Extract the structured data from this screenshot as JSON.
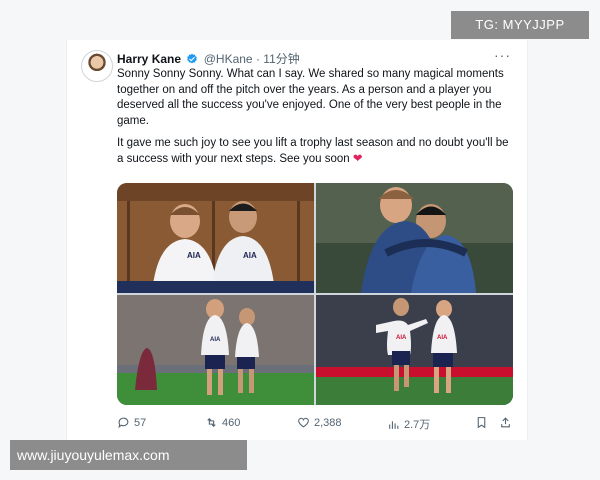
{
  "tweet": {
    "author_name": "Harry Kane",
    "handle": "@HKane",
    "separator": "·",
    "time_ago": "11分钟",
    "more_label": "···",
    "paragraph1": "Sonny Sonny Sonny. What can I say. We shared so many magical moments together on and off the pitch over the years. As a person and a player you deserved all the success you've enjoyed. One of the very best people in the game.",
    "paragraph2": "It gave me such joy to see you lift a trophy last season and no doubt you'll be a success with your next steps. See you soon",
    "heart_emoji": "❤",
    "verified_color": "#1d9bf0",
    "photos": [
      {
        "description_name": "kane-son-locker-room-photo"
      },
      {
        "description_name": "kane-son-hug-photo"
      },
      {
        "description_name": "kane-son-celebration-photo"
      },
      {
        "description_name": "son-kane-running-photo"
      }
    ],
    "jersey_text": "AIA"
  },
  "actions": {
    "replies": "57",
    "retweets": "460",
    "likes": "2,388",
    "views": "2.7万"
  },
  "watermarks": {
    "top": "TG: MYYJJPP",
    "bottom": "www.jiuyouyulemax.com"
  }
}
